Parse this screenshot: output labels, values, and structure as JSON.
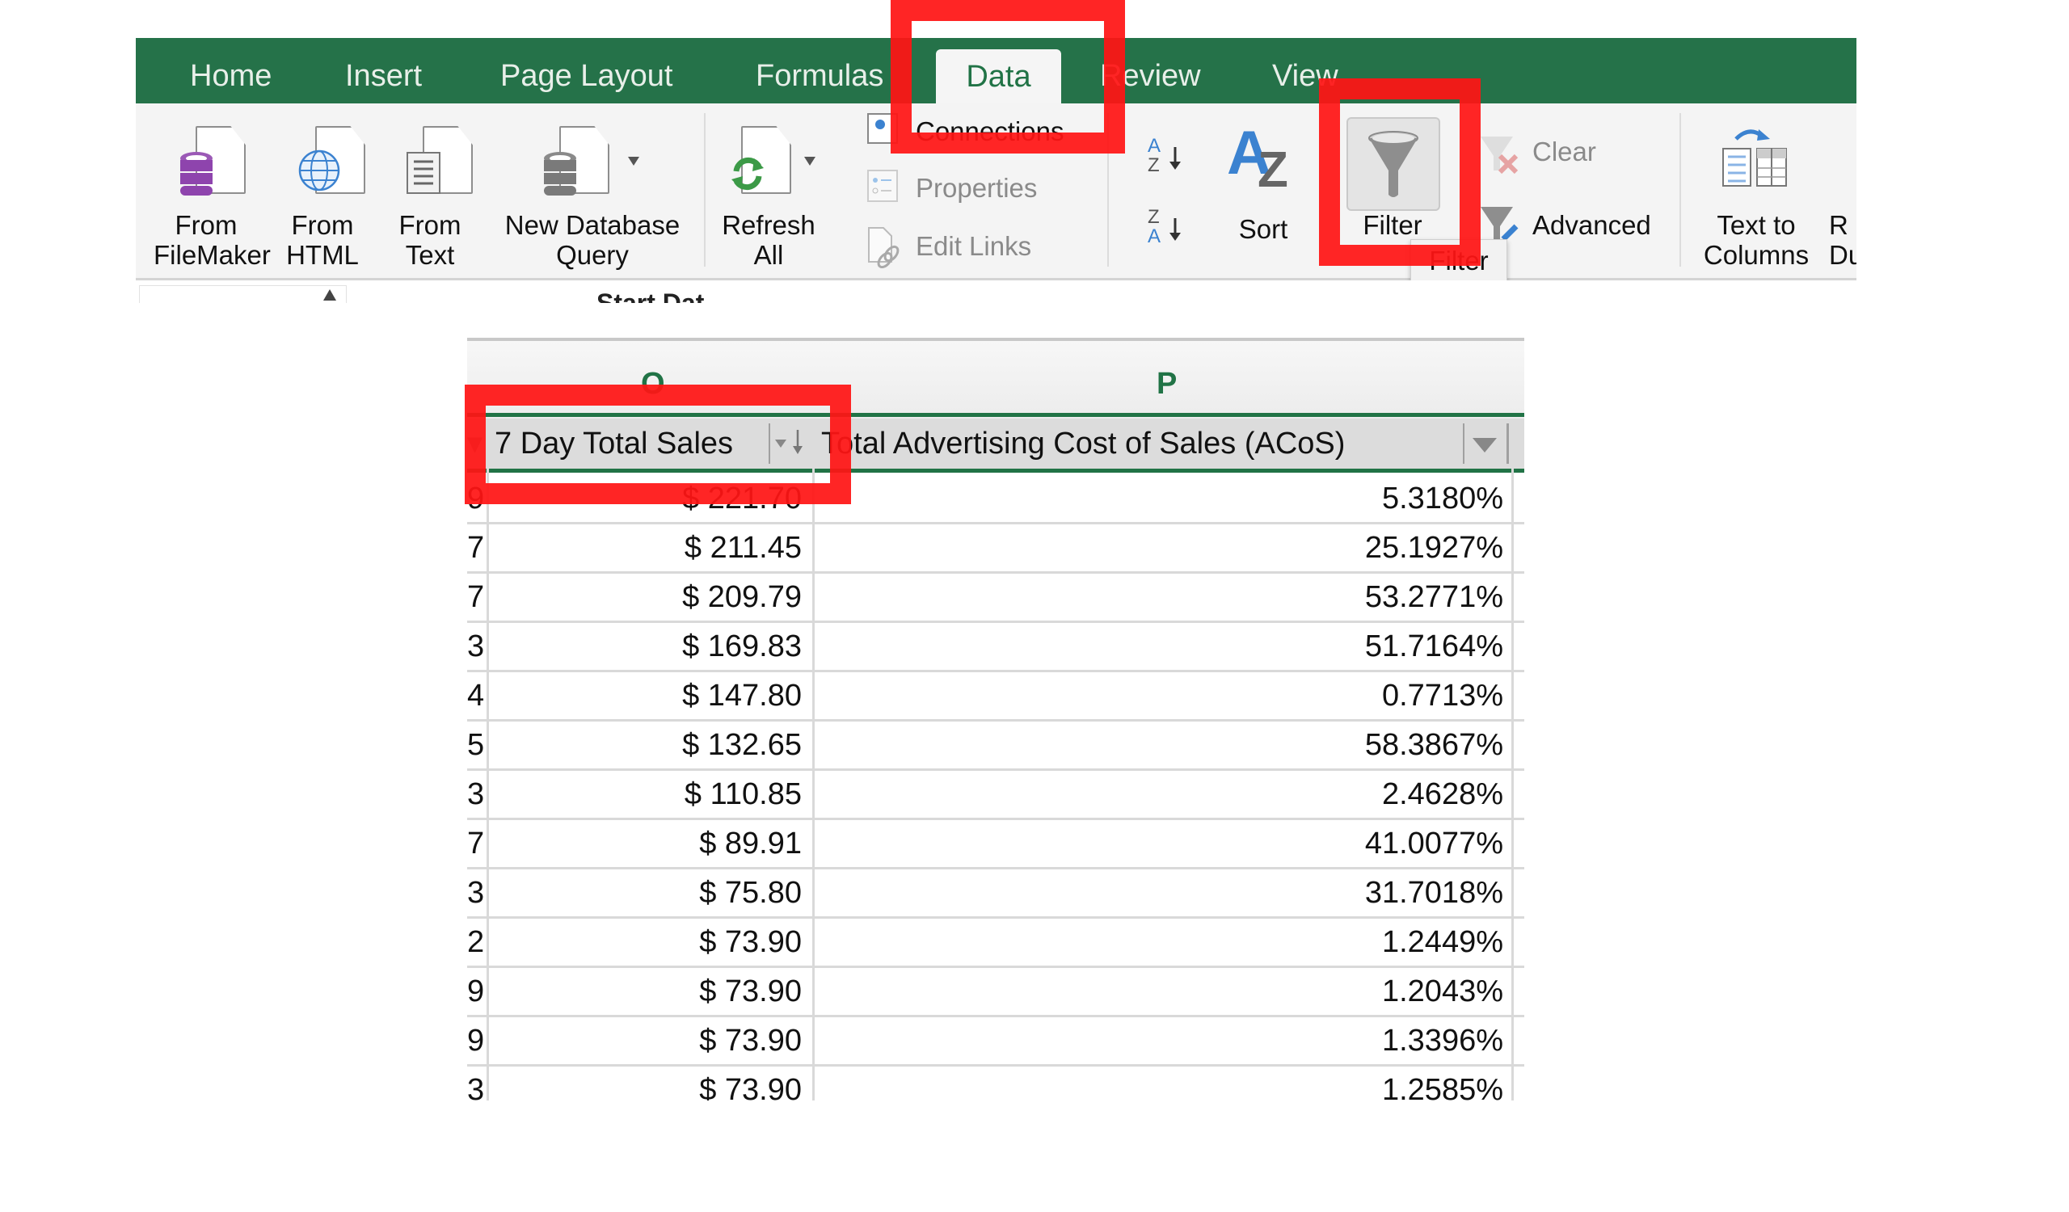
{
  "ribbon": {
    "tabs": [
      {
        "label": "Home"
      },
      {
        "label": "Insert"
      },
      {
        "label": "Page Layout"
      },
      {
        "label": "Formulas"
      },
      {
        "label": "Data",
        "active": true
      },
      {
        "label": "Review"
      },
      {
        "label": "View"
      }
    ],
    "get_external_data": {
      "from_filemaker": [
        "From",
        "FileMaker"
      ],
      "from_html": [
        "From",
        "HTML"
      ],
      "from_text": [
        "From",
        "Text"
      ],
      "new_database_query": [
        "New Database",
        "Query"
      ]
    },
    "refresh_all": [
      "Refresh",
      "All"
    ],
    "connections": {
      "connections": "Connections",
      "properties": "Properties",
      "edit_links": "Edit Links"
    },
    "sort_filter": {
      "sort": "Sort",
      "filter": "Filter",
      "clear": "Clear",
      "advanced": "Advanced"
    },
    "data_tools": {
      "text_to_columns": [
        "Text to",
        "Columns"
      ],
      "remove_duplicates_partial": [
        "R",
        "Du"
      ]
    },
    "tooltip": "Filter"
  },
  "formula_bar": {
    "content_partial": "Start Dat"
  },
  "sheet": {
    "columns": [
      {
        "letter": "O",
        "header": "7 Day Total Sales",
        "sorted": "descending"
      },
      {
        "letter": "P",
        "header": "Total Advertising Cost of Sales (ACoS)"
      }
    ],
    "rows": [
      {
        "left_partial": "9",
        "sales": "$ 221.70",
        "acos": "5.3180%"
      },
      {
        "left_partial": "7",
        "sales": "$ 211.45",
        "acos": "25.1927%"
      },
      {
        "left_partial": "7",
        "sales": "$ 209.79",
        "acos": "53.2771%"
      },
      {
        "left_partial": "3",
        "sales": "$ 169.83",
        "acos": "51.7164%"
      },
      {
        "left_partial": "4",
        "sales": "$ 147.80",
        "acos": "0.7713%"
      },
      {
        "left_partial": "5",
        "sales": "$ 132.65",
        "acos": "58.3867%"
      },
      {
        "left_partial": "3",
        "sales": "$ 110.85",
        "acos": "2.4628%"
      },
      {
        "left_partial": "7",
        "sales": "$ 89.91",
        "acos": "41.0077%"
      },
      {
        "left_partial": "3",
        "sales": "$ 75.80",
        "acos": "31.7018%"
      },
      {
        "left_partial": "2",
        "sales": "$ 73.90",
        "acos": "1.2449%"
      },
      {
        "left_partial": "9",
        "sales": "$ 73.90",
        "acos": "1.2043%"
      },
      {
        "left_partial": "9",
        "sales": "$ 73.90",
        "acos": "1.3396%"
      },
      {
        "left_partial": "3",
        "sales": "$ 73.90",
        "acos": "1.2585%"
      }
    ]
  },
  "colors": {
    "ribbon_green": "#257249",
    "column_letter_green": "#217346",
    "annotation_red": "#ff1414"
  }
}
